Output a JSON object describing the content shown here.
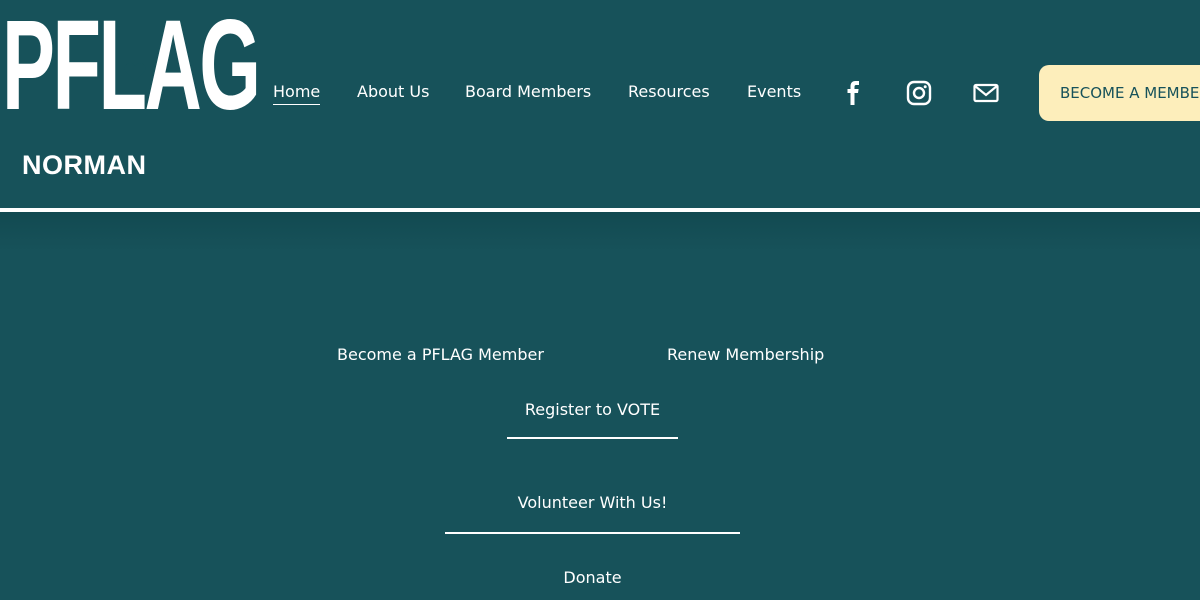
{
  "logo": {
    "word": "PFLAG",
    "subtitle": "NORMAN",
    "heart_icon": "heart-icon"
  },
  "nav": {
    "items": [
      {
        "label": "Home",
        "active": true
      },
      {
        "label": "About Us",
        "active": false
      },
      {
        "label": "Board Members",
        "active": false
      },
      {
        "label": "Resources",
        "active": false
      },
      {
        "label": "Events",
        "active": false
      }
    ]
  },
  "social": {
    "icons": [
      "facebook-icon",
      "instagram-icon",
      "mail-icon"
    ]
  },
  "cta": {
    "label": "BECOME A MEMBER"
  },
  "main": {
    "links": {
      "become_member": "Become a PFLAG Member",
      "renew": "Renew Membership",
      "register_vote": "Register to VOTE",
      "volunteer": "Volunteer With Us!",
      "donate": "Donate"
    }
  },
  "colors": {
    "background": "#17525a",
    "cta_background": "#fdeebb",
    "text": "#ffffff"
  }
}
